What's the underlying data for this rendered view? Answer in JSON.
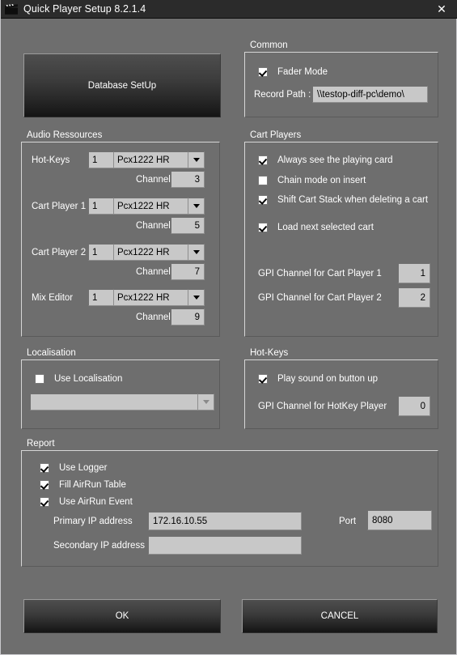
{
  "window": {
    "title": "Quick Player Setup 8.2.1.4",
    "icon": "clapperboard-icon",
    "close_label": "✕",
    "background_color": "#6e6e6e",
    "titlebar_color": "#2b2b2b"
  },
  "database_button": {
    "label": "Database SetUp"
  },
  "audio_ressources": {
    "group_label": "Audio Ressources",
    "channel_label": "Channel",
    "rows": [
      {
        "label": "Hot-Keys",
        "index": "1",
        "device": "Pcx1222 HR",
        "channel": "3"
      },
      {
        "label": "Cart Player 1",
        "index": "1",
        "device": "Pcx1222 HR",
        "channel": "5"
      },
      {
        "label": "Cart Player 2",
        "index": "1",
        "device": "Pcx1222 HR",
        "channel": "7"
      },
      {
        "label": "Mix Editor",
        "index": "1",
        "device": "Pcx1222 HR",
        "channel": "9"
      }
    ]
  },
  "localisation": {
    "group_label": "Localisation",
    "use_localisation_label": "Use Localisation",
    "use_localisation_checked": false,
    "language_value": "",
    "language_enabled": false
  },
  "common": {
    "group_label": "Common",
    "fader_mode_label": "Fader Mode",
    "fader_mode_checked": true,
    "record_path_label": "Record Path :",
    "record_path_value": "\\\\testop-diff-pc\\demo\\"
  },
  "cart_players": {
    "group_label": "Cart Players",
    "checkboxes": [
      {
        "label": "Always see the playing card",
        "checked": true
      },
      {
        "label": "Chain mode on insert",
        "checked": false
      },
      {
        "label": "Shift Cart Stack when deleting a cart",
        "checked": true
      },
      {
        "label": "Load next selected cart",
        "checked": true
      }
    ],
    "gpi": [
      {
        "label": "GPI Channel for Cart Player 1",
        "value": "1"
      },
      {
        "label": "GPI Channel for Cart Player 2",
        "value": "2"
      }
    ]
  },
  "hot_keys": {
    "group_label": "Hot-Keys",
    "play_sound_label": "Play sound on button up",
    "play_sound_checked": true,
    "gpi_label": "GPI Channel for HotKey Player",
    "gpi_value": "0"
  },
  "report": {
    "group_label": "Report",
    "checkboxes": [
      {
        "label": "Use Logger",
        "checked": true
      },
      {
        "label": "Fill AirRun Table",
        "checked": true
      },
      {
        "label": "Use AirRun Event",
        "checked": true
      }
    ],
    "primary_ip_label": "Primary IP address",
    "primary_ip_value": "172.16.10.55",
    "secondary_ip_label": "Secondary IP address",
    "secondary_ip_value": "",
    "port_label": "Port",
    "port_value": "8080"
  },
  "footer": {
    "ok_label": "OK",
    "cancel_label": "CANCEL"
  }
}
